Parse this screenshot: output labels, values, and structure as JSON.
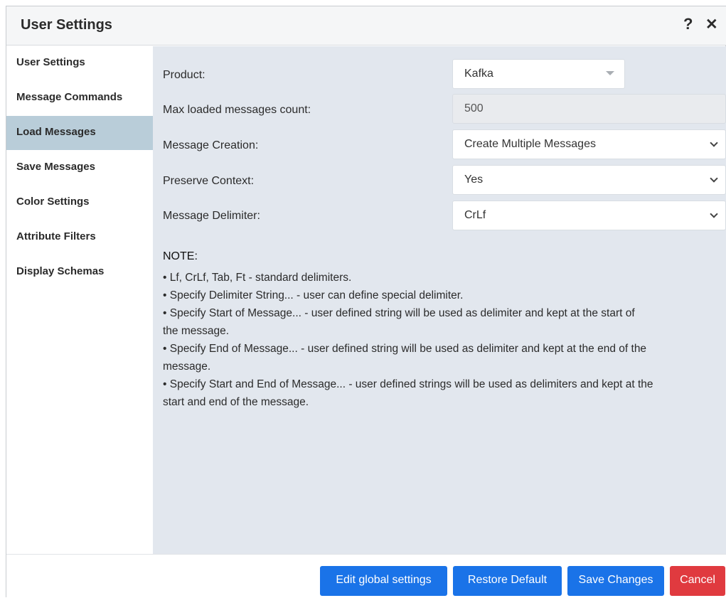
{
  "dialog": {
    "title": "User Settings",
    "help_glyph": "?",
    "close_glyph": "✕"
  },
  "sidebar": {
    "items": [
      {
        "label": "User Settings"
      },
      {
        "label": "Message Commands"
      },
      {
        "label": "Load Messages",
        "active": true
      },
      {
        "label": "Save Messages"
      },
      {
        "label": "Color Settings"
      },
      {
        "label": "Attribute Filters"
      },
      {
        "label": "Display Schemas"
      }
    ]
  },
  "form": {
    "product": {
      "label": "Product:",
      "value": "Kafka"
    },
    "max_loaded": {
      "label": "Max loaded messages count:",
      "value": "500"
    },
    "message_creation": {
      "label": "Message Creation:",
      "value": "Create Multiple Messages"
    },
    "preserve_context": {
      "label": "Preserve Context:",
      "value": "Yes"
    },
    "message_delimiter": {
      "label": "Message Delimiter:",
      "value": "CrLf"
    }
  },
  "note": {
    "title": "NOTE:",
    "lines": [
      "• Lf, CrLf, Tab, Ft - standard delimiters.",
      "• Specify Delimiter String... - user can define special delimiter.",
      "• Specify Start of Message... - user defined string will be used as delimiter and kept at the start of",
      "the message.",
      "• Specify End of Message... - user defined string will be used as delimiter and kept at the end of the",
      "message.",
      "• Specify Start and End of Message... - user defined strings will be used as delimiters and kept at the",
      "start and end of the message."
    ]
  },
  "footer": {
    "edit_global": "Edit global settings",
    "restore_default": "Restore Default",
    "save_changes": "Save Changes",
    "cancel": "Cancel"
  },
  "colors": {
    "accent_blue": "#1a73e8",
    "cancel_red": "#e03a3f",
    "active_nav": "#b9cdd9",
    "content_bg": "#e2e7ee"
  }
}
